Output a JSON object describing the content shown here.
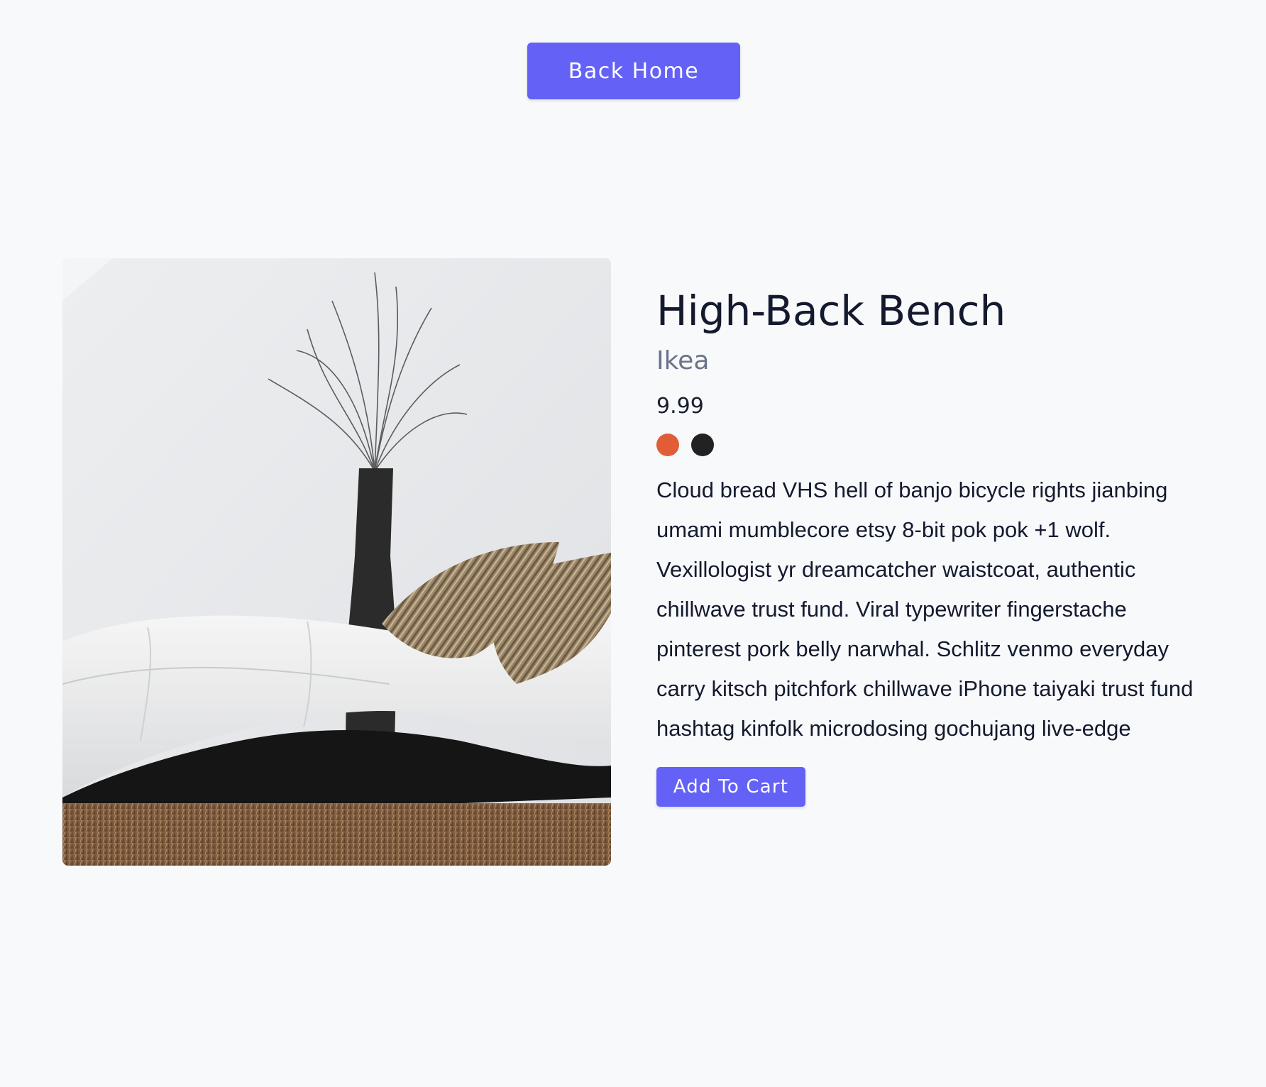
{
  "header": {
    "back_home_label": "Back Home"
  },
  "product": {
    "title": "High-Back Bench",
    "brand": "Ikea",
    "price": "9.99",
    "colors": [
      "#e05d36",
      "#222222"
    ],
    "description": "Cloud bread VHS hell of banjo bicycle rights jianbing umami mumblecore etsy 8-bit pok pok +1 wolf. Vexillologist yr dreamcatcher waistcoat, authentic chillwave trust fund. Viral typewriter fingerstache pinterest pork belly narwhal. Schlitz venmo everyday carry kitsch pitchfork chillwave iPhone taiyaki trust fund hashtag kinfolk microdosing gochujang live-edge",
    "add_to_cart_label": "Add To Cart"
  },
  "colors": {
    "accent": "#6461f6",
    "background": "#f8f9fb"
  }
}
